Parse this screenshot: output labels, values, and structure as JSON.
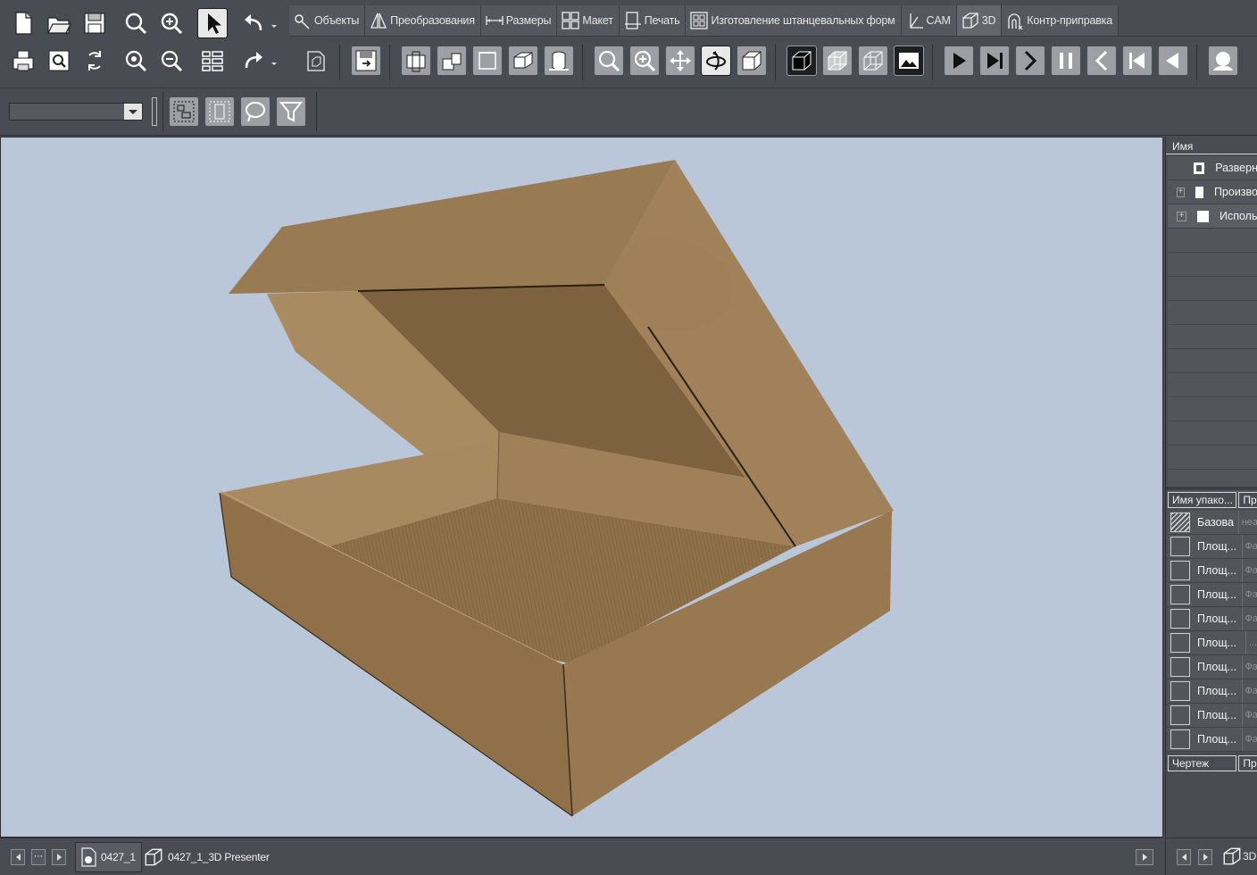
{
  "ribbon": {
    "tabs": [
      {
        "label": "Объекты",
        "icon": "objects-icon"
      },
      {
        "label": "Преобразования",
        "icon": "transform-icon"
      },
      {
        "label": "Размеры",
        "icon": "dimensions-icon"
      },
      {
        "label": "Макет",
        "icon": "layout-icon"
      },
      {
        "label": "Печать",
        "icon": "print-icon"
      },
      {
        "label": "Изготовление штанцевальных форм",
        "icon": "die-making-icon"
      },
      {
        "label": "CAM",
        "icon": "cam-icon"
      },
      {
        "label": "3D",
        "icon": "3d-cube-icon"
      },
      {
        "label": "Контр-приправка",
        "icon": "counter-icon"
      }
    ],
    "active_tab": "3D"
  },
  "properties_panel": {
    "column_header": "Имя",
    "tree_rows": [
      {
        "label": "Разверн",
        "icon": "square-frame-icon"
      },
      {
        "label": "Произво",
        "icon": "white-square-icon"
      },
      {
        "label": "Исполь",
        "icon": "white-square-icon"
      }
    ]
  },
  "packaging_table": {
    "headers": [
      "Имя упако...",
      "Пр"
    ],
    "rows": [
      {
        "name": "Базова...",
        "desc": "неа"
      },
      {
        "name": "Площ...",
        "desc": "Фа"
      },
      {
        "name": "Площ...",
        "desc": "Фа"
      },
      {
        "name": "Площ...",
        "desc": "Фа"
      },
      {
        "name": "Площ...",
        "desc": "Фа"
      },
      {
        "name": "Площ...",
        "desc": "..."
      },
      {
        "name": "Площ...",
        "desc": "Фа"
      },
      {
        "name": "Площ...",
        "desc": "Фа"
      },
      {
        "name": "Площ...",
        "desc": "Фа"
      },
      {
        "name": "Площ...",
        "desc": "Фа"
      }
    ],
    "footer_headers": [
      "Чертеж",
      "Пр"
    ]
  },
  "document_tabs": [
    {
      "label": "0427_1",
      "icon": "drawing-doc-icon"
    },
    {
      "label": "0427_1_3D Presenter",
      "icon": "3d-doc-icon"
    }
  ],
  "right_bottom_label": "3D",
  "colors": {
    "viewport_bg": "#bac7d8",
    "cardboard": "#9b7b54",
    "ui_bg": "#4a4c53"
  }
}
